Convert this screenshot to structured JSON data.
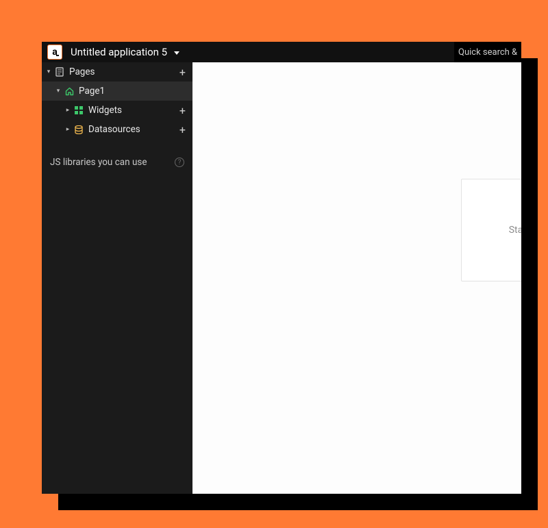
{
  "topbar": {
    "logo_text": "a",
    "app_title": "Untitled application 5",
    "search_text": "Quick search &"
  },
  "sidebar": {
    "pages_label": "Pages",
    "page1_label": "Page1",
    "widgets_label": "Widgets",
    "datasources_label": "Datasources",
    "js_libraries_label": "JS libraries you can use"
  },
  "canvas": {
    "starter_text": "Sta"
  },
  "glyphs": {
    "chevron_down": "▾",
    "chevron_right": "▸",
    "plus": "+",
    "help": "?"
  }
}
